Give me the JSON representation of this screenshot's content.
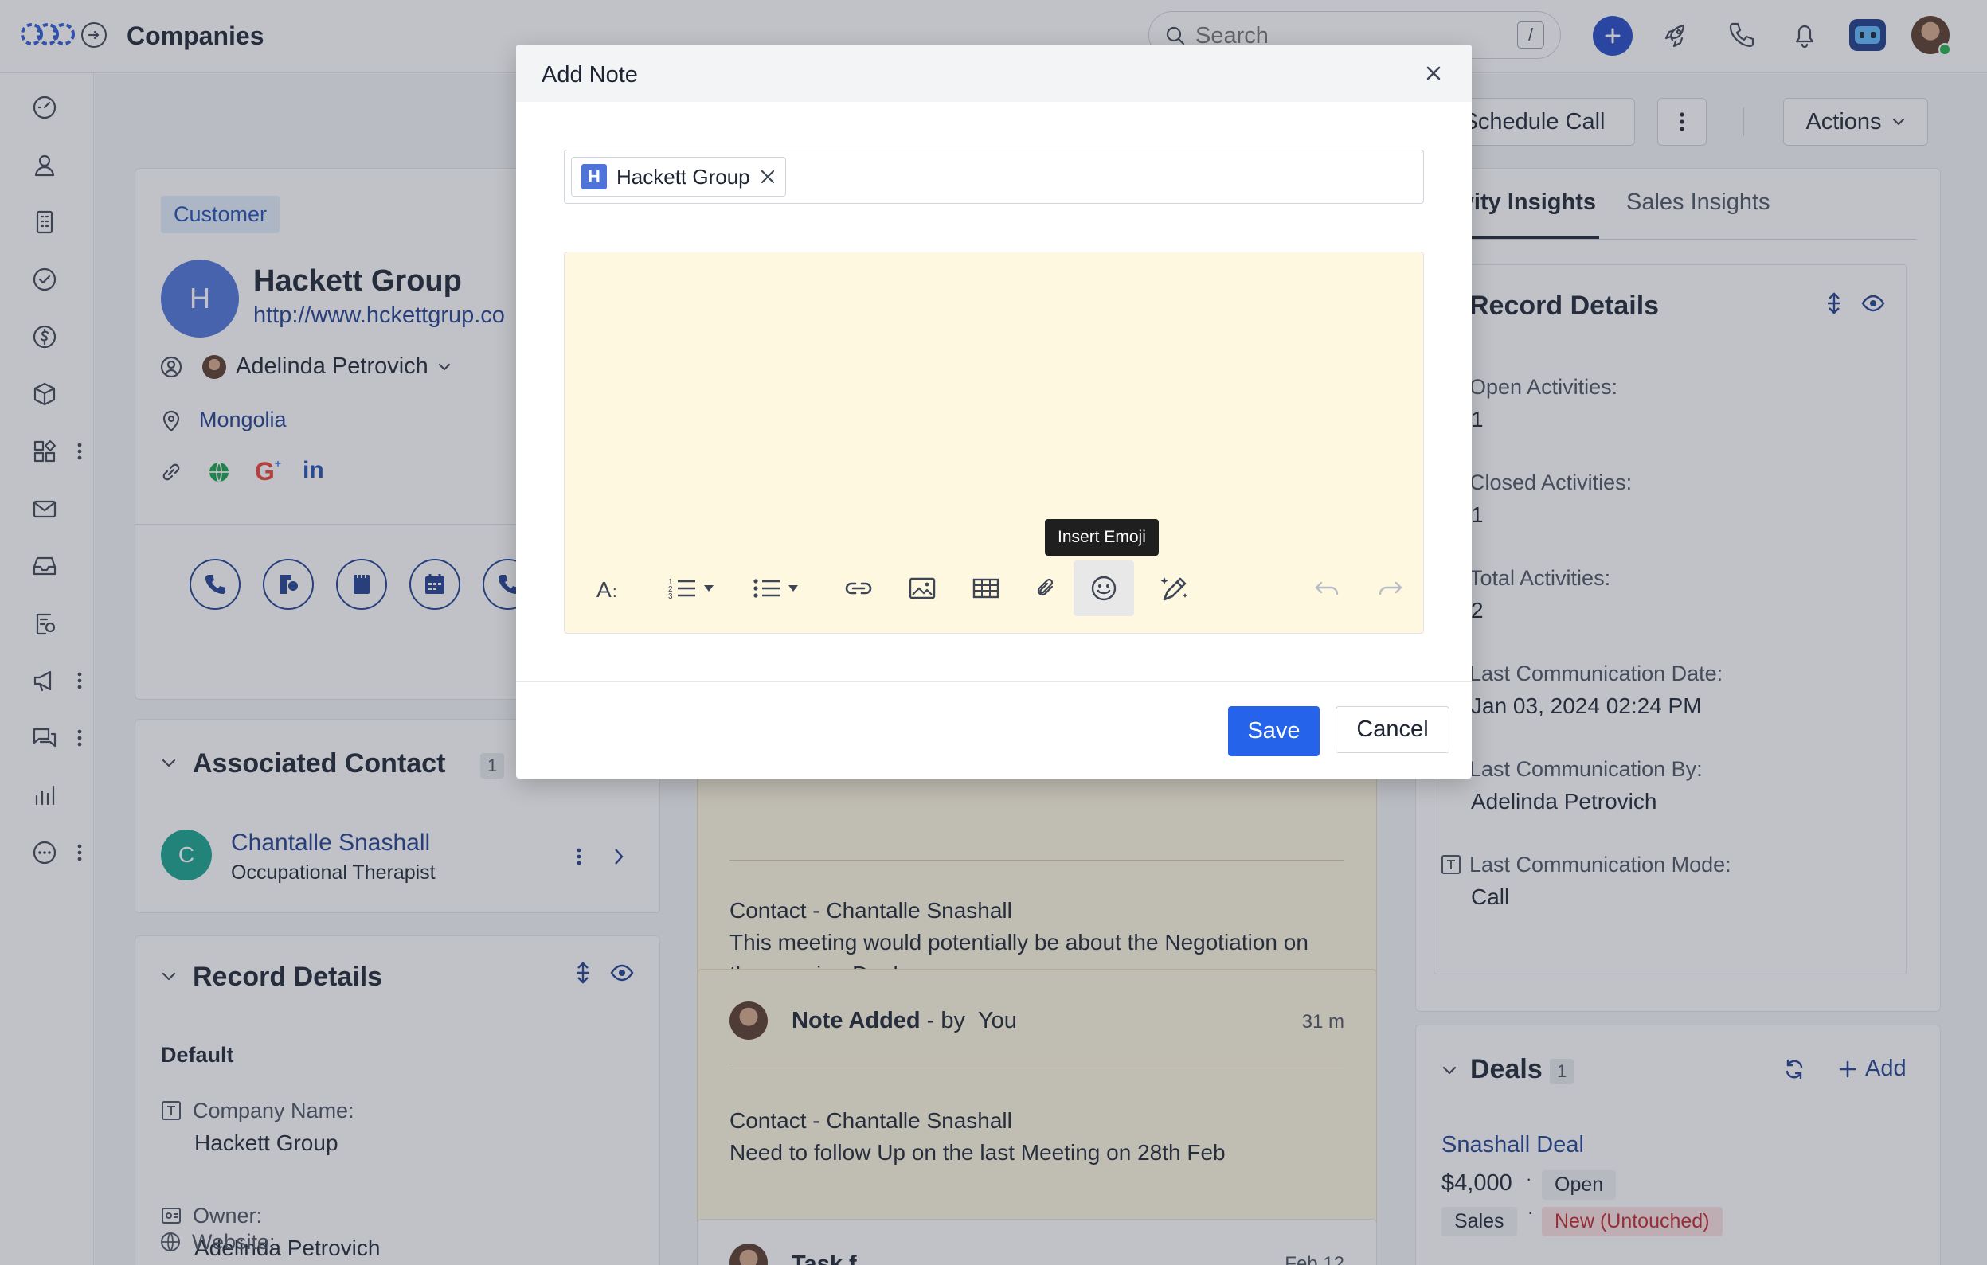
{
  "topbar": {
    "title": "Companies",
    "search_placeholder": "Search",
    "search_shortcut": "/"
  },
  "sidebar": {
    "items": [
      "dashboard-icon",
      "contacts-icon",
      "companies-icon",
      "tasks-icon",
      "deals-icon",
      "products-icon",
      "apps-icon",
      "email-icon",
      "inbox-icon",
      "documents-icon",
      "campaigns-icon",
      "chat-icon",
      "reports-icon",
      "more-icon"
    ]
  },
  "header_actions": {
    "schedule_call": "Schedule Call",
    "actions": "Actions"
  },
  "company": {
    "badge": "Customer",
    "avatar_letter": "H",
    "name": "Hackett Group",
    "url": "http://www.hckettgrup.co",
    "owner": "Adelinda Petrovich",
    "location": "Mongolia"
  },
  "associated_contact": {
    "title": "Associated Contact",
    "count": "1",
    "avatar_letter": "C",
    "name": "Chantalle Snashall",
    "role": "Occupational Therapist"
  },
  "record_details_left": {
    "title": "Record Details",
    "group": "Default",
    "fields": [
      {
        "label": "Company Name:",
        "value": "Hackett Group"
      },
      {
        "label": "Owner:",
        "value": "Adelinda Petrovich"
      },
      {
        "label": "Website:",
        "value": ""
      }
    ]
  },
  "timeline": {
    "note1": {
      "line1": "Contact - Chantalle Snashall",
      "line2": "This meeting would potentially be about the Negotiation on",
      "line3": "the ongoing Deal"
    },
    "note2": {
      "title": "Note Added",
      "by": "- by",
      "author": "You",
      "time": "31 m",
      "line1": "Contact - Chantalle Snashall",
      "line2": "Need to follow Up on the last Meeting on 28th Feb"
    },
    "note3": {
      "title": "Task f",
      "time": "Feb 12"
    }
  },
  "right_tabs": {
    "tab1": "Activity Insights",
    "tab2": "Sales Insights"
  },
  "record_details_right": {
    "title": "Record Details",
    "fields": [
      {
        "label": "Open Activities:",
        "value": "1"
      },
      {
        "label": "Closed Activities:",
        "value": "1"
      },
      {
        "label": "Total Activities:",
        "value": "2"
      },
      {
        "label": "Last Communication Date:",
        "value": "Jan 03, 2024 02:24 PM"
      },
      {
        "label": "Last Communication By:",
        "value": "Adelinda Petrovich"
      },
      {
        "label": "Last Communication Mode:",
        "value": "Call"
      }
    ]
  },
  "deals": {
    "title": "Deals",
    "count": "1",
    "add": "Add",
    "deal_name": "Snashall Deal",
    "amount": "$4,000",
    "status": "Open",
    "pipeline": "Sales",
    "stage": "New (Untouched)"
  },
  "modal": {
    "title": "Add Note",
    "chip_letter": "H",
    "chip_label": "Hackett Group",
    "tooltip": "Insert Emoji",
    "save": "Save",
    "cancel": "Cancel"
  },
  "colors": {
    "primary": "#2563eb",
    "link": "#1f3e8f",
    "note_bg": "#fff8e1",
    "badge_bg": "#e3eefc"
  }
}
